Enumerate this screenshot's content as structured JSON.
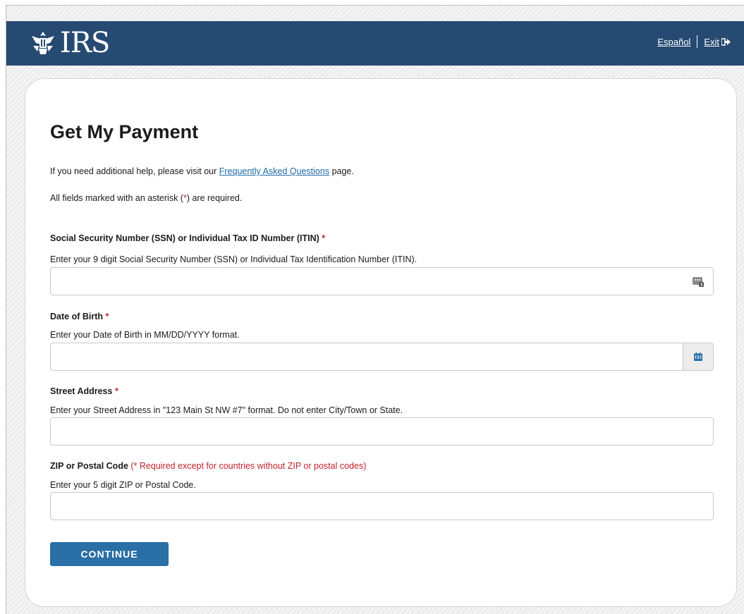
{
  "header": {
    "logo_text": "IRS",
    "links": {
      "espanol": "Español",
      "exit": "Exit"
    }
  },
  "page": {
    "title": "Get My Payment",
    "help_before": "If you need additional help, please visit our ",
    "help_link": "Frequently Asked Questions",
    "help_after": " page.",
    "required_before": "All fields marked with an asterisk (",
    "required_star": "*",
    "required_after": ") are required."
  },
  "fields": {
    "ssn": {
      "label": "Social Security Number (SSN) or Individual Tax ID Number (ITIN)",
      "required_mark": "*",
      "help": "Enter your 9 digit Social Security Number (SSN) or Individual Tax Identification Number (ITIN).",
      "value": ""
    },
    "dob": {
      "label": "Date of Birth",
      "required_mark": "*",
      "help": "Enter your Date of Birth in MM/DD/YYYY format.",
      "value": ""
    },
    "street": {
      "label": "Street Address",
      "required_mark": "*",
      "help": "Enter your Street Address in \"123 Main St NW #7\" format. Do not enter City/Town or State.",
      "value": ""
    },
    "zip": {
      "label": "ZIP or Postal Code",
      "note": "(* Required except for countries without ZIP or postal codes)",
      "help": "Enter your 5 digit ZIP or Postal Code.",
      "value": ""
    }
  },
  "buttons": {
    "continue": "CONTINUE"
  },
  "icons": {
    "logo": "irs-eagle-icon",
    "exit": "exit-arrow-icon",
    "ssn": "keypad-icon",
    "dob": "calendar-icon"
  },
  "colors": {
    "header_bg": "#264a72",
    "link": "#1f6ba8",
    "required": "#c0232b",
    "button": "#2a6fa6"
  }
}
